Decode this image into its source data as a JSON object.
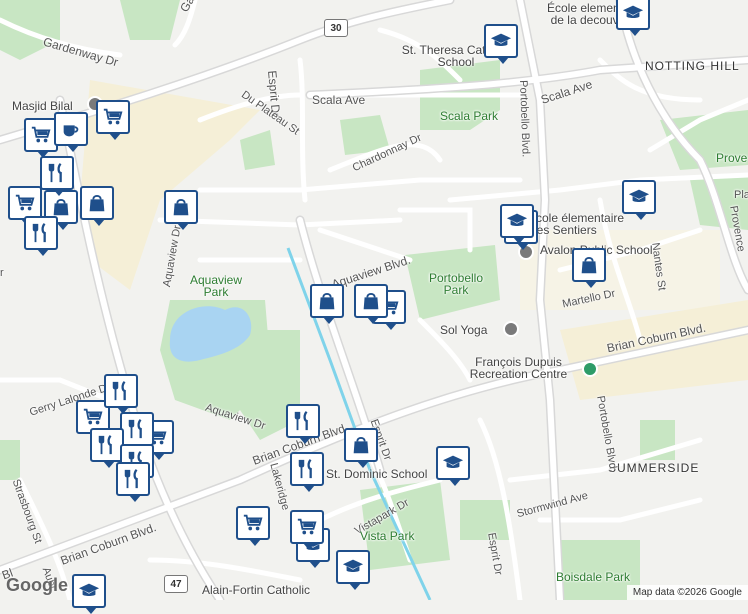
{
  "map": {
    "colors": {
      "land": "#f2f2ef",
      "park": "#c8e6c3",
      "road_major": "#ffffff",
      "road_outline": "#d6d6d6",
      "transit_line": "#7fd3ea",
      "marker": "#1f4f8b",
      "school_zone": "#f7f0d9"
    },
    "highway_shields": [
      "30",
      "47"
    ],
    "area_labels": [
      "NOTTING HILL",
      "SUMMERSIDE"
    ],
    "street_labels": [
      "Gardenway Dr",
      "Esprit Dr",
      "Du Plateau St",
      "Scala Ave",
      "Scala Ave",
      "Chardonnay Dr",
      "Portobello Blvd.",
      "Aquaview Blvd.",
      "Aquaview Dr",
      "Martello Dr",
      "Nantes St",
      "Provence",
      "Brian Coburn Blvd.",
      "Brian Coburn Blvd.",
      "Brian Coburn Blvd.",
      "Gerry Lalonde Dr",
      "Aquaview Dr",
      "Lakeridge",
      "Esprit Dr",
      "Portobello Blvd.",
      "Stormwind Ave",
      "Vistapark Dr",
      "Esprit Dr",
      "Strasbourg St",
      "Garden",
      "Aubr",
      "Bl",
      "r",
      "Pla"
    ],
    "park_labels": [
      "Scala Park",
      "Portobello Park",
      "Aquaview Park",
      "Vista Park",
      "Boisdale Park",
      "Prove"
    ],
    "poi_labels": [
      "École elementaire de la decouverte",
      "St. Theresa Catholic School",
      "Masjid Bilal",
      "École élementaire Des Sentiers",
      "Avalon Public School",
      "Sol Yoga",
      "François Dupuis Recreation Centre",
      "St. Dominic School",
      "Alain-Fortin Catholic"
    ],
    "markers": [
      "school-icon",
      "school-icon",
      "school-icon",
      "school-icon",
      "school-icon",
      "school-icon",
      "school-icon",
      "school-icon",
      "school-icon",
      "shopping-cart-icon",
      "shopping-cart-icon",
      "shopping-cart-icon",
      "shopping-cart-icon",
      "shopping-cart-icon",
      "shopping-cart-icon",
      "shopping-cart-icon",
      "shopping-cart-icon",
      "shopping-bag-icon",
      "shopping-bag-icon",
      "shopping-bag-icon",
      "shopping-bag-icon",
      "shopping-bag-icon",
      "shopping-bag-icon",
      "shopping-bag-icon",
      "restaurant-icon",
      "restaurant-icon",
      "restaurant-icon",
      "restaurant-icon",
      "restaurant-icon",
      "restaurant-icon",
      "restaurant-icon",
      "restaurant-icon",
      "restaurant-icon",
      "cafe-icon"
    ],
    "logo": "Google",
    "attribution": "Map data ©2026 Google"
  }
}
